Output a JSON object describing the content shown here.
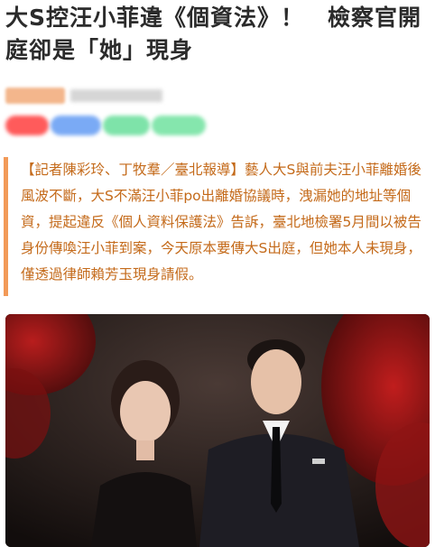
{
  "article": {
    "headline": "大S控汪小菲違《個資法》！　檢察官開庭卻是「她」現身",
    "lead": "【記者陳彩玲、丁牧羣／臺北報導】藝人大S與前夫汪小菲離婚後風波不斷，大S不滿汪小菲po出離婚協議時，洩漏她的地址等個資，提起違反《個人資料保護法》告訴，臺北地檢署5月間以被告身份傳喚汪小菲到案，今天原本要傳大S出庭，但她本人未現身，僅透過律師賴芳玉現身請假。"
  },
  "colors": {
    "quote_text": "#c46a1a",
    "quote_border": "#f29a58",
    "headline": "#2b2b2b"
  }
}
